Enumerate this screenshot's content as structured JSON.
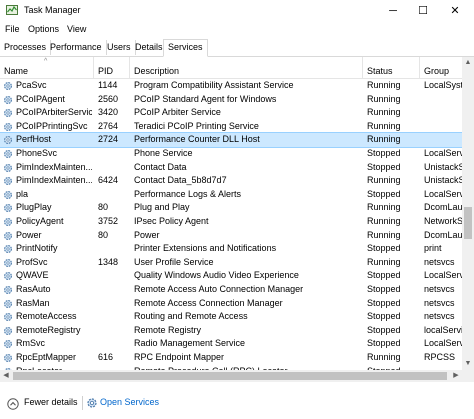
{
  "window": {
    "title": "Task Manager",
    "minimize": "─",
    "maximize": "☐",
    "close": "✕"
  },
  "menu": [
    "File",
    "Options",
    "View"
  ],
  "tabs": [
    "Processes",
    "Performance",
    "Users",
    "Details",
    "Services"
  ],
  "active_tab": "Services",
  "columns": {
    "name": "Name",
    "pid": "PID",
    "description": "Description",
    "status": "Status",
    "group": "Group"
  },
  "rows": [
    {
      "name": "PcaSvc",
      "pid": "1144",
      "description": "Program Compatibility Assistant Service",
      "status": "Running",
      "group": "LocalSyste"
    },
    {
      "name": "PCoIPAgent",
      "pid": "2560",
      "description": "PCoIP Standard Agent for Windows",
      "status": "Running",
      "group": ""
    },
    {
      "name": "PCoIPArbiterService",
      "pid": "3420",
      "description": "PCoIP Arbiter Service",
      "status": "Running",
      "group": ""
    },
    {
      "name": "PCoIPPrintingSvc",
      "pid": "2764",
      "description": "Teradici PCoIP Printing Service",
      "status": "Running",
      "group": ""
    },
    {
      "name": "PerfHost",
      "pid": "2724",
      "description": "Performance Counter DLL Host",
      "status": "Running",
      "group": "",
      "selected": true
    },
    {
      "name": "PhoneSvc",
      "pid": "",
      "description": "Phone Service",
      "status": "Stopped",
      "group": "LocalServi"
    },
    {
      "name": "PimIndexMainten...",
      "pid": "",
      "description": "Contact Data",
      "status": "Stopped",
      "group": "UnistackS"
    },
    {
      "name": "PimIndexMainten...",
      "pid": "6424",
      "description": "Contact Data_5b8d7d7",
      "status": "Running",
      "group": "UnistackS"
    },
    {
      "name": "pla",
      "pid": "",
      "description": "Performance Logs & Alerts",
      "status": "Stopped",
      "group": "LocalServi"
    },
    {
      "name": "PlugPlay",
      "pid": "80",
      "description": "Plug and Play",
      "status": "Running",
      "group": "DcomLau"
    },
    {
      "name": "PolicyAgent",
      "pid": "3752",
      "description": "IPsec Policy Agent",
      "status": "Running",
      "group": "NetworkS"
    },
    {
      "name": "Power",
      "pid": "80",
      "description": "Power",
      "status": "Running",
      "group": "DcomLau"
    },
    {
      "name": "PrintNotify",
      "pid": "",
      "description": "Printer Extensions and Notifications",
      "status": "Stopped",
      "group": "print"
    },
    {
      "name": "ProfSvc",
      "pid": "1348",
      "description": "User Profile Service",
      "status": "Running",
      "group": "netsvcs"
    },
    {
      "name": "QWAVE",
      "pid": "",
      "description": "Quality Windows Audio Video Experience",
      "status": "Stopped",
      "group": "LocalServi"
    },
    {
      "name": "RasAuto",
      "pid": "",
      "description": "Remote Access Auto Connection Manager",
      "status": "Stopped",
      "group": "netsvcs"
    },
    {
      "name": "RasMan",
      "pid": "",
      "description": "Remote Access Connection Manager",
      "status": "Stopped",
      "group": "netsvcs"
    },
    {
      "name": "RemoteAccess",
      "pid": "",
      "description": "Routing and Remote Access",
      "status": "Stopped",
      "group": "netsvcs"
    },
    {
      "name": "RemoteRegistry",
      "pid": "",
      "description": "Remote Registry",
      "status": "Stopped",
      "group": "localServi"
    },
    {
      "name": "RmSvc",
      "pid": "",
      "description": "Radio Management Service",
      "status": "Stopped",
      "group": "LocalServi"
    },
    {
      "name": "RpcEptMapper",
      "pid": "616",
      "description": "RPC Endpoint Mapper",
      "status": "Running",
      "group": "RPCSS"
    },
    {
      "name": "RpcLocator",
      "pid": "",
      "description": "Remote Procedure Call (RPC) Locator",
      "status": "Stopped",
      "group": ""
    }
  ],
  "footer": {
    "fewer_details": "Fewer details",
    "open_services": "Open Services"
  },
  "colors": {
    "selection": "#cce8ff",
    "link": "#0066cc"
  }
}
